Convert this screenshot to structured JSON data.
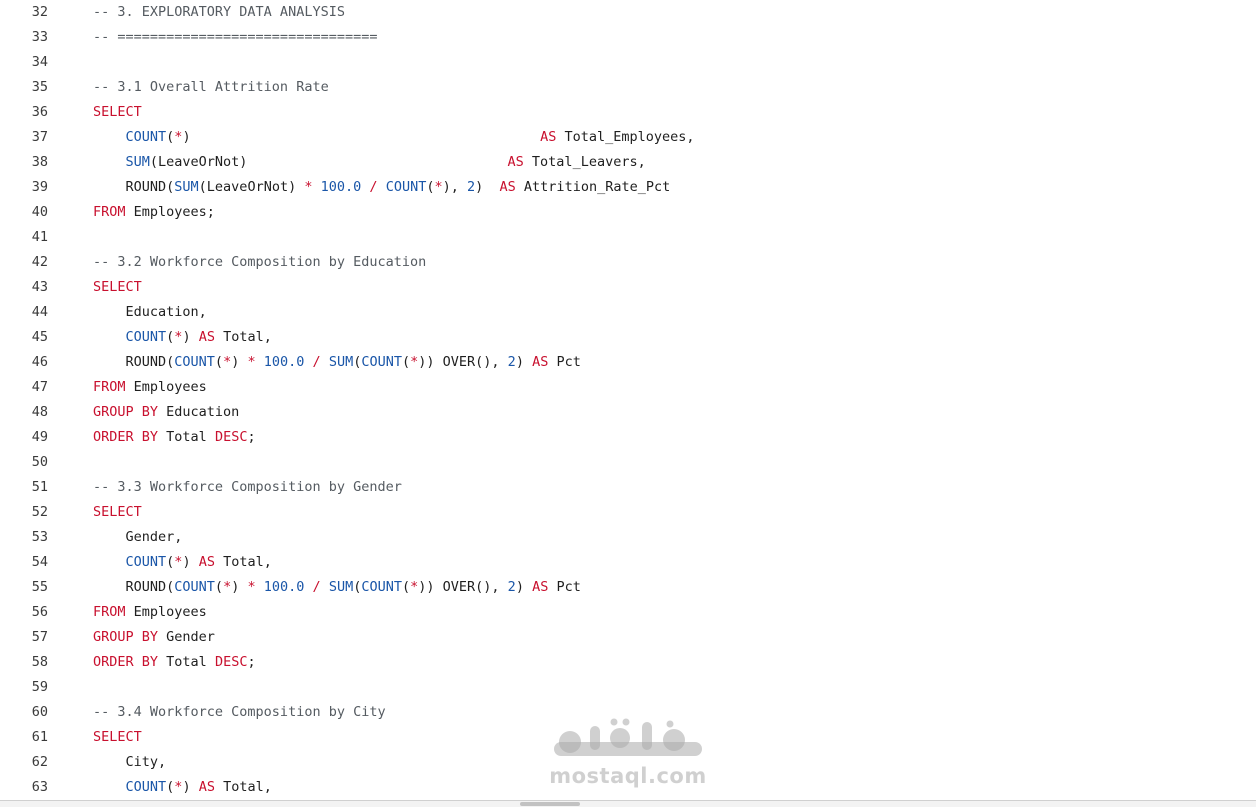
{
  "editor": {
    "lines": [
      {
        "num": "32",
        "tokens": [
          {
            "t": "-- 3. EXPLORATORY DATA ANALYSIS",
            "c": "c"
          }
        ]
      },
      {
        "num": "33",
        "tokens": [
          {
            "t": "-- ================================",
            "c": "c"
          }
        ]
      },
      {
        "num": "34",
        "tokens": []
      },
      {
        "num": "35",
        "tokens": [
          {
            "t": "-- 3.1 Overall Attrition Rate",
            "c": "c"
          }
        ]
      },
      {
        "num": "36",
        "tokens": [
          {
            "t": "SELECT",
            "c": "k"
          }
        ]
      },
      {
        "num": "37",
        "tokens": [
          {
            "t": "    ",
            "c": "p"
          },
          {
            "t": "COUNT",
            "c": "f"
          },
          {
            "t": "(",
            "c": "p"
          },
          {
            "t": "*",
            "c": "k"
          },
          {
            "t": ")                                           ",
            "c": "p"
          },
          {
            "t": "AS",
            "c": "k"
          },
          {
            "t": " Total_Employees,",
            "c": "p"
          }
        ]
      },
      {
        "num": "38",
        "tokens": [
          {
            "t": "    ",
            "c": "p"
          },
          {
            "t": "SUM",
            "c": "f"
          },
          {
            "t": "(LeaveOrNot)                                ",
            "c": "p"
          },
          {
            "t": "AS",
            "c": "k"
          },
          {
            "t": " Total_Leavers,",
            "c": "p"
          }
        ]
      },
      {
        "num": "39",
        "tokens": [
          {
            "t": "    ROUND(",
            "c": "p"
          },
          {
            "t": "SUM",
            "c": "f"
          },
          {
            "t": "(LeaveOrNot) ",
            "c": "p"
          },
          {
            "t": "*",
            "c": "k"
          },
          {
            "t": " ",
            "c": "p"
          },
          {
            "t": "100.0",
            "c": "f"
          },
          {
            "t": " ",
            "c": "p"
          },
          {
            "t": "/",
            "c": "k"
          },
          {
            "t": " ",
            "c": "p"
          },
          {
            "t": "COUNT",
            "c": "f"
          },
          {
            "t": "(",
            "c": "p"
          },
          {
            "t": "*",
            "c": "k"
          },
          {
            "t": "), ",
            "c": "p"
          },
          {
            "t": "2",
            "c": "f"
          },
          {
            "t": ")  ",
            "c": "p"
          },
          {
            "t": "AS",
            "c": "k"
          },
          {
            "t": " Attrition_Rate_Pct",
            "c": "p"
          }
        ]
      },
      {
        "num": "40",
        "tokens": [
          {
            "t": "FROM",
            "c": "k"
          },
          {
            "t": " Employees;",
            "c": "p"
          }
        ]
      },
      {
        "num": "41",
        "tokens": []
      },
      {
        "num": "42",
        "tokens": [
          {
            "t": "-- 3.2 Workforce Composition by Education",
            "c": "c"
          }
        ]
      },
      {
        "num": "43",
        "tokens": [
          {
            "t": "SELECT",
            "c": "k"
          }
        ]
      },
      {
        "num": "44",
        "tokens": [
          {
            "t": "    Education,",
            "c": "p"
          }
        ]
      },
      {
        "num": "45",
        "tokens": [
          {
            "t": "    ",
            "c": "p"
          },
          {
            "t": "COUNT",
            "c": "f"
          },
          {
            "t": "(",
            "c": "p"
          },
          {
            "t": "*",
            "c": "k"
          },
          {
            "t": ") ",
            "c": "p"
          },
          {
            "t": "AS",
            "c": "k"
          },
          {
            "t": " Total,",
            "c": "p"
          }
        ]
      },
      {
        "num": "46",
        "tokens": [
          {
            "t": "    ROUND(",
            "c": "p"
          },
          {
            "t": "COUNT",
            "c": "f"
          },
          {
            "t": "(",
            "c": "p"
          },
          {
            "t": "*",
            "c": "k"
          },
          {
            "t": ") ",
            "c": "p"
          },
          {
            "t": "*",
            "c": "k"
          },
          {
            "t": " ",
            "c": "p"
          },
          {
            "t": "100.0",
            "c": "f"
          },
          {
            "t": " ",
            "c": "p"
          },
          {
            "t": "/",
            "c": "k"
          },
          {
            "t": " ",
            "c": "p"
          },
          {
            "t": "SUM",
            "c": "f"
          },
          {
            "t": "(",
            "c": "p"
          },
          {
            "t": "COUNT",
            "c": "f"
          },
          {
            "t": "(",
            "c": "p"
          },
          {
            "t": "*",
            "c": "k"
          },
          {
            "t": ")) OVER(), ",
            "c": "p"
          },
          {
            "t": "2",
            "c": "f"
          },
          {
            "t": ") ",
            "c": "p"
          },
          {
            "t": "AS",
            "c": "k"
          },
          {
            "t": " Pct",
            "c": "p"
          }
        ]
      },
      {
        "num": "47",
        "tokens": [
          {
            "t": "FROM",
            "c": "k"
          },
          {
            "t": " Employees",
            "c": "p"
          }
        ]
      },
      {
        "num": "48",
        "tokens": [
          {
            "t": "GROUP BY",
            "c": "k"
          },
          {
            "t": " Education",
            "c": "p"
          }
        ]
      },
      {
        "num": "49",
        "tokens": [
          {
            "t": "ORDER BY",
            "c": "k"
          },
          {
            "t": " Total ",
            "c": "p"
          },
          {
            "t": "DESC",
            "c": "k"
          },
          {
            "t": ";",
            "c": "p"
          }
        ]
      },
      {
        "num": "50",
        "tokens": []
      },
      {
        "num": "51",
        "tokens": [
          {
            "t": "-- 3.3 Workforce Composition by Gender",
            "c": "c"
          }
        ]
      },
      {
        "num": "52",
        "tokens": [
          {
            "t": "SELECT",
            "c": "k"
          }
        ]
      },
      {
        "num": "53",
        "tokens": [
          {
            "t": "    Gender,",
            "c": "p"
          }
        ]
      },
      {
        "num": "54",
        "tokens": [
          {
            "t": "    ",
            "c": "p"
          },
          {
            "t": "COUNT",
            "c": "f"
          },
          {
            "t": "(",
            "c": "p"
          },
          {
            "t": "*",
            "c": "k"
          },
          {
            "t": ") ",
            "c": "p"
          },
          {
            "t": "AS",
            "c": "k"
          },
          {
            "t": " Total,",
            "c": "p"
          }
        ]
      },
      {
        "num": "55",
        "tokens": [
          {
            "t": "    ROUND(",
            "c": "p"
          },
          {
            "t": "COUNT",
            "c": "f"
          },
          {
            "t": "(",
            "c": "p"
          },
          {
            "t": "*",
            "c": "k"
          },
          {
            "t": ") ",
            "c": "p"
          },
          {
            "t": "*",
            "c": "k"
          },
          {
            "t": " ",
            "c": "p"
          },
          {
            "t": "100.0",
            "c": "f"
          },
          {
            "t": " ",
            "c": "p"
          },
          {
            "t": "/",
            "c": "k"
          },
          {
            "t": " ",
            "c": "p"
          },
          {
            "t": "SUM",
            "c": "f"
          },
          {
            "t": "(",
            "c": "p"
          },
          {
            "t": "COUNT",
            "c": "f"
          },
          {
            "t": "(",
            "c": "p"
          },
          {
            "t": "*",
            "c": "k"
          },
          {
            "t": ")) OVER(), ",
            "c": "p"
          },
          {
            "t": "2",
            "c": "f"
          },
          {
            "t": ") ",
            "c": "p"
          },
          {
            "t": "AS",
            "c": "k"
          },
          {
            "t": " Pct",
            "c": "p"
          }
        ]
      },
      {
        "num": "56",
        "tokens": [
          {
            "t": "FROM",
            "c": "k"
          },
          {
            "t": " Employees",
            "c": "p"
          }
        ]
      },
      {
        "num": "57",
        "tokens": [
          {
            "t": "GROUP BY",
            "c": "k"
          },
          {
            "t": " Gender",
            "c": "p"
          }
        ]
      },
      {
        "num": "58",
        "tokens": [
          {
            "t": "ORDER BY",
            "c": "k"
          },
          {
            "t": " Total ",
            "c": "p"
          },
          {
            "t": "DESC",
            "c": "k"
          },
          {
            "t": ";",
            "c": "p"
          }
        ]
      },
      {
        "num": "59",
        "tokens": []
      },
      {
        "num": "60",
        "tokens": [
          {
            "t": "-- 3.4 Workforce Composition by City",
            "c": "c"
          }
        ]
      },
      {
        "num": "61",
        "tokens": [
          {
            "t": "SELECT",
            "c": "k"
          }
        ]
      },
      {
        "num": "62",
        "tokens": [
          {
            "t": "    City,",
            "c": "p"
          }
        ]
      },
      {
        "num": "63",
        "tokens": [
          {
            "t": "    ",
            "c": "p"
          },
          {
            "t": "COUNT",
            "c": "f"
          },
          {
            "t": "(",
            "c": "p"
          },
          {
            "t": "*",
            "c": "k"
          },
          {
            "t": ") ",
            "c": "p"
          },
          {
            "t": "AS",
            "c": "k"
          },
          {
            "t": " Total,",
            "c": "p"
          }
        ]
      }
    ]
  },
  "watermark": {
    "logo_text": "مستقل",
    "site": "mostaql.com"
  },
  "colors": {
    "keyword": "#c8102e",
    "function": "#1a56a8",
    "comment": "#555b61",
    "plain": "#1f1f1f",
    "line_number": "#3a3a3a",
    "background": "#ffffff"
  }
}
